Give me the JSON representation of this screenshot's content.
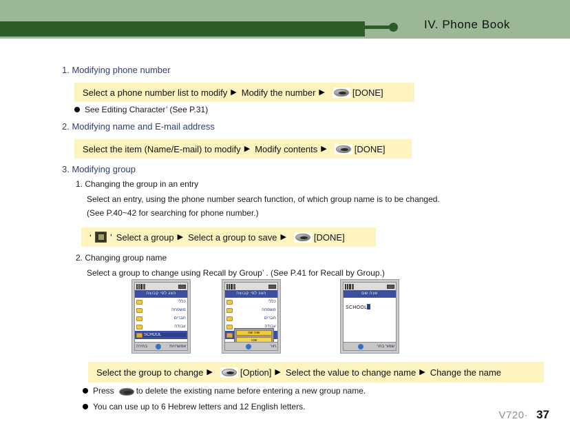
{
  "header": {
    "title": "IV. Phone Book",
    "band_color": "#9cb795",
    "bar_color": "#2c5c27"
  },
  "sections": [
    {
      "number": "1.",
      "title": "Modifying phone number",
      "step_box": {
        "part1": "Select a phone number list to modify",
        "arrow1": "▶",
        "part2": "Modify the number",
        "arrow2": "▶",
        "icon": "done-key-icon",
        "part3": "[DONE]"
      },
      "note": "See  Editing Character’ (See P.31)"
    },
    {
      "number": "2.",
      "title": "Modifying name and E-mail address",
      "step_box": {
        "part1": "Select the item (Name/E-mail) to modify",
        "arrow1": "▶",
        "part2": "Modify contents",
        "arrow2": "▶",
        "icon": "done-key-icon",
        "part3": "[DONE]"
      }
    },
    {
      "number": "3.",
      "title": "Modifying group",
      "subsections": [
        {
          "number": "1.",
          "title": "Changing the group in an entry",
          "lines": [
            "Select an entry, using the phone number search function, of which group name is to be changed.",
            "(See P.40~42 for searching for phone number.)"
          ],
          "step_box": {
            "quote_open": "‘",
            "icon": "group-square-icon",
            "quote_close": "’",
            "part1": "Select a group",
            "arrow1": "▶",
            "part2": "Select a group to save",
            "arrow2": "▶",
            "icon2": "done-key-icon",
            "part3": "[DONE]"
          }
        },
        {
          "number": "2.",
          "title": "Changing group name",
          "lines": [
            "Select a group to change using Recall by Group’ . (See P.41 for Recall by Group.)"
          ]
        }
      ]
    }
  ],
  "phone_screens": [
    {
      "name": "group-list-screen",
      "title": "הצג לפי קבוצה",
      "rows": [
        "כללי",
        "משפחה",
        "חברים",
        "עבודה"
      ],
      "selected_value": "SCHOOL",
      "soft_left": "בחירה",
      "soft_right": "אפשרויות"
    },
    {
      "name": "group-option-popup-screen",
      "title": "הצג לפי קבוצה",
      "rows": [
        "כללי",
        "משפחה",
        "חברים",
        "עבודה"
      ],
      "popup_title": "שנה שם",
      "popup_items": [
        "שנה",
        "בטל"
      ],
      "soft_right": "חור"
    },
    {
      "name": "group-name-edit-screen",
      "title": "שנה שם",
      "entry_value": "SCHOOL",
      "soft_text": "שמור בחר"
    }
  ],
  "bottom_step_box": {
    "part1": "Select the group to change",
    "arrow1": "▶",
    "icon": "option-key-icon",
    "part2": "[Option]",
    "arrow2": "▶",
    "part3": "Select the value to change name",
    "arrow3": "▶",
    "part4": "Change the name"
  },
  "bottom_notes": [
    {
      "prefix": "Press",
      "icon": "clear-key-icon",
      "suffix": "to delete the existing name before entering a new group name."
    },
    {
      "text": "You can use up to 6 Hebrew letters and 12 English letters."
    }
  ],
  "footer": {
    "model": "V720·",
    "page": "37"
  }
}
